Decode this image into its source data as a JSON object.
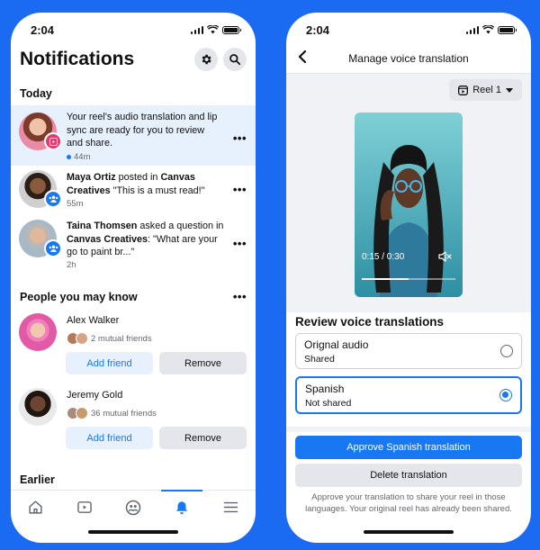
{
  "colors": {
    "background": "#1a6af2",
    "accent": "#1877f2",
    "highlight": "#e7f0fd"
  },
  "left": {
    "status_time": "2:04",
    "title": "Notifications",
    "icons": [
      "gear-icon",
      "search-icon"
    ],
    "today_label": "Today",
    "notifications": [
      {
        "line1": "Your reel's audio translation and lip",
        "line2": "sync are ready for you to review",
        "line3": "and share.",
        "time": "44m",
        "unread": true
      },
      {
        "bold1": "Maya Ortiz",
        "plain1": " posted in ",
        "bold2": "Canvas",
        "bold3": "Creatives",
        "plain2": " \"This is a must read!\"",
        "time": "55m"
      },
      {
        "bold1": "Taina Thomsen",
        "plain1": " asked a question in",
        "bold2": "Canvas Creatives",
        "plain2": ": \"What are your",
        "line3": "go to paint br...\"",
        "time": "2h"
      }
    ],
    "people_label": "People you may know",
    "people": [
      {
        "name": "Alex Walker",
        "mutual": "2 mutual friends",
        "add": "Add friend",
        "remove": "Remove"
      },
      {
        "name": "Jeremy Gold",
        "mutual": "36 mutual friends",
        "add": "Add friend",
        "remove": "Remove"
      }
    ],
    "earlier_label": "Earlier",
    "nav": [
      "home-icon",
      "video-icon",
      "groups-icon",
      "bell-icon",
      "menu-icon"
    ]
  },
  "right": {
    "status_time": "2:04",
    "header_title": "Manage voice translation",
    "reel_label": "Reel 1",
    "video_time": "0:15 / 0:30",
    "video_progress": 0.5,
    "review_title": "Review voice translations",
    "options": [
      {
        "title": "Orignal audio",
        "sub": "Shared",
        "selected": false
      },
      {
        "title": "Spanish",
        "sub": "Not shared",
        "selected": true
      }
    ],
    "approve_label": "Approve Spanish translation",
    "delete_label": "Delete translation",
    "footnote": "Approve your translation to share your reel in those languages. Your original reel has already been shared."
  }
}
